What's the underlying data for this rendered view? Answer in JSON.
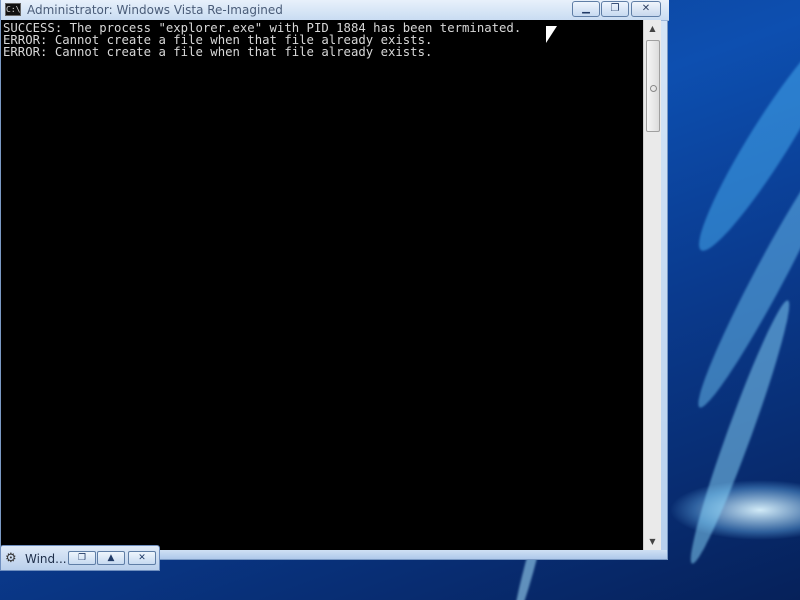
{
  "window": {
    "title": "Administrator: Windows Vista Re-Imagined",
    "icon_text": "C:\\",
    "controls": {
      "minimize_icon": "minimize-icon",
      "maximize_icon": "maximize-icon",
      "close_icon": "close-icon",
      "minimize_glyph": "▁",
      "maximize_glyph": "❐",
      "close_glyph": "✕"
    }
  },
  "console": {
    "lines": [
      "SUCCESS: The process \"explorer.exe\" with PID 1884 has been terminated.",
      "ERROR: Cannot create a file when that file already exists.",
      "ERROR: Cannot create a file when that file already exists."
    ]
  },
  "scrollbar": {
    "up_glyph": "▲",
    "down_glyph": "▼"
  },
  "minimized_window": {
    "title": "Wind...",
    "icon_glyph": "⚙",
    "restore_glyph": "❐",
    "maximize_glyph": "▲",
    "close_glyph": "✕"
  }
}
